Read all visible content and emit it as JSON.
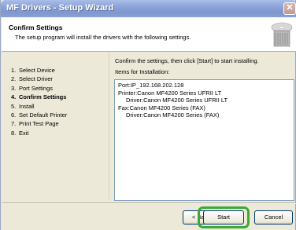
{
  "window": {
    "title": "MF Drivers - Setup Wizard",
    "close_glyph": "✕"
  },
  "header": {
    "title": "Confirm Settings",
    "subtitle": "The setup program will install the drivers with the following settings.",
    "icon": "printer-cd-icon"
  },
  "steps": [
    {
      "num": "1.",
      "label": "Select Device"
    },
    {
      "num": "2.",
      "label": "Select Driver"
    },
    {
      "num": "3.",
      "label": "Port Settings"
    },
    {
      "num": "4.",
      "label": "Confirm Settings"
    },
    {
      "num": "5.",
      "label": "Install"
    },
    {
      "num": "6.",
      "label": "Set Default Printer"
    },
    {
      "num": "7.",
      "label": "Print Test Page"
    },
    {
      "num": "8.",
      "label": "Exit"
    }
  ],
  "main": {
    "instruction": "Confirm the settings, then click [Start] to start installing.",
    "items_label": "Items for Installation:",
    "items": [
      "Port:IP_192.168.202.128",
      "Printer:Canon MF4200 Series UFRII LT",
      "Driver:Canon MF4200 Series UFRII LT",
      "Fax:Canon MF4200 Series (FAX)",
      "Driver:Canon MF4200 Series (FAX)"
    ]
  },
  "buttons": {
    "back": "< Back",
    "start": "Start",
    "cancel": "Cancel"
  },
  "colors": {
    "highlight": "#3aaa35",
    "titlebar": "#8ea6d9"
  }
}
